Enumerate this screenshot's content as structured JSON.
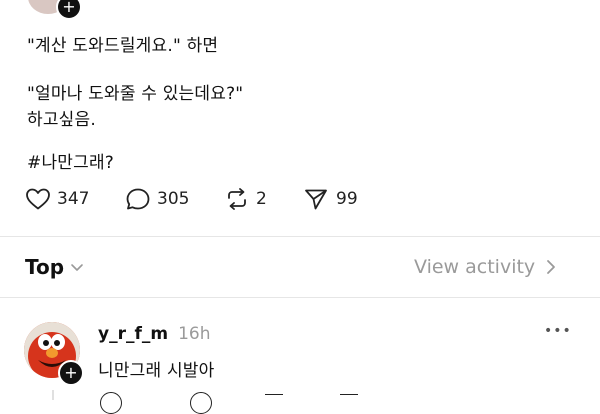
{
  "post": {
    "lines": [
      "\"계산 도와드릴게요.\" 하면",
      "\"얼마나 도와줄 수 있는데요?\"",
      "하고싶음.",
      "#나만그래?"
    ],
    "actions": {
      "likes": "347",
      "replies": "305",
      "reposts": "2",
      "shares": "99"
    }
  },
  "sort": {
    "label": "Top",
    "view_activity": "View activity"
  },
  "reply": {
    "username": "y_r_f_m",
    "time": "16h",
    "text": "니만그래 시발아",
    "more": "•••"
  },
  "colors": {
    "text": "#111111",
    "muted": "#9a9a9a",
    "divider": "#e6e6e6"
  }
}
